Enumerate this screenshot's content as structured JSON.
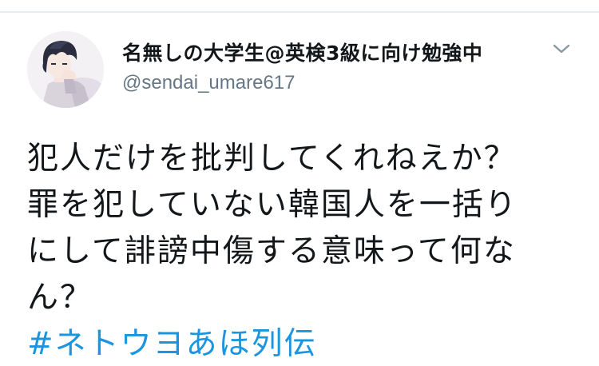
{
  "tweet": {
    "display_name": "名無しの大学生@英検3級に向け勉強中",
    "handle": "@sendai_umare617",
    "lines": [
      "犯人だけを批判してくれねえか？",
      "罪を犯していない韓国人を一括り",
      "にして誹謗中傷する意味って何な",
      "ん？"
    ],
    "hashtag": "#ネトウヨあほ列伝"
  },
  "icons": {
    "avatar": "anime-avatar",
    "menu": "chevron-down-icon"
  },
  "colors": {
    "text": "#14171a",
    "secondary": "#657786",
    "link": "#1b95e0",
    "divider": "#e6ecf0"
  }
}
